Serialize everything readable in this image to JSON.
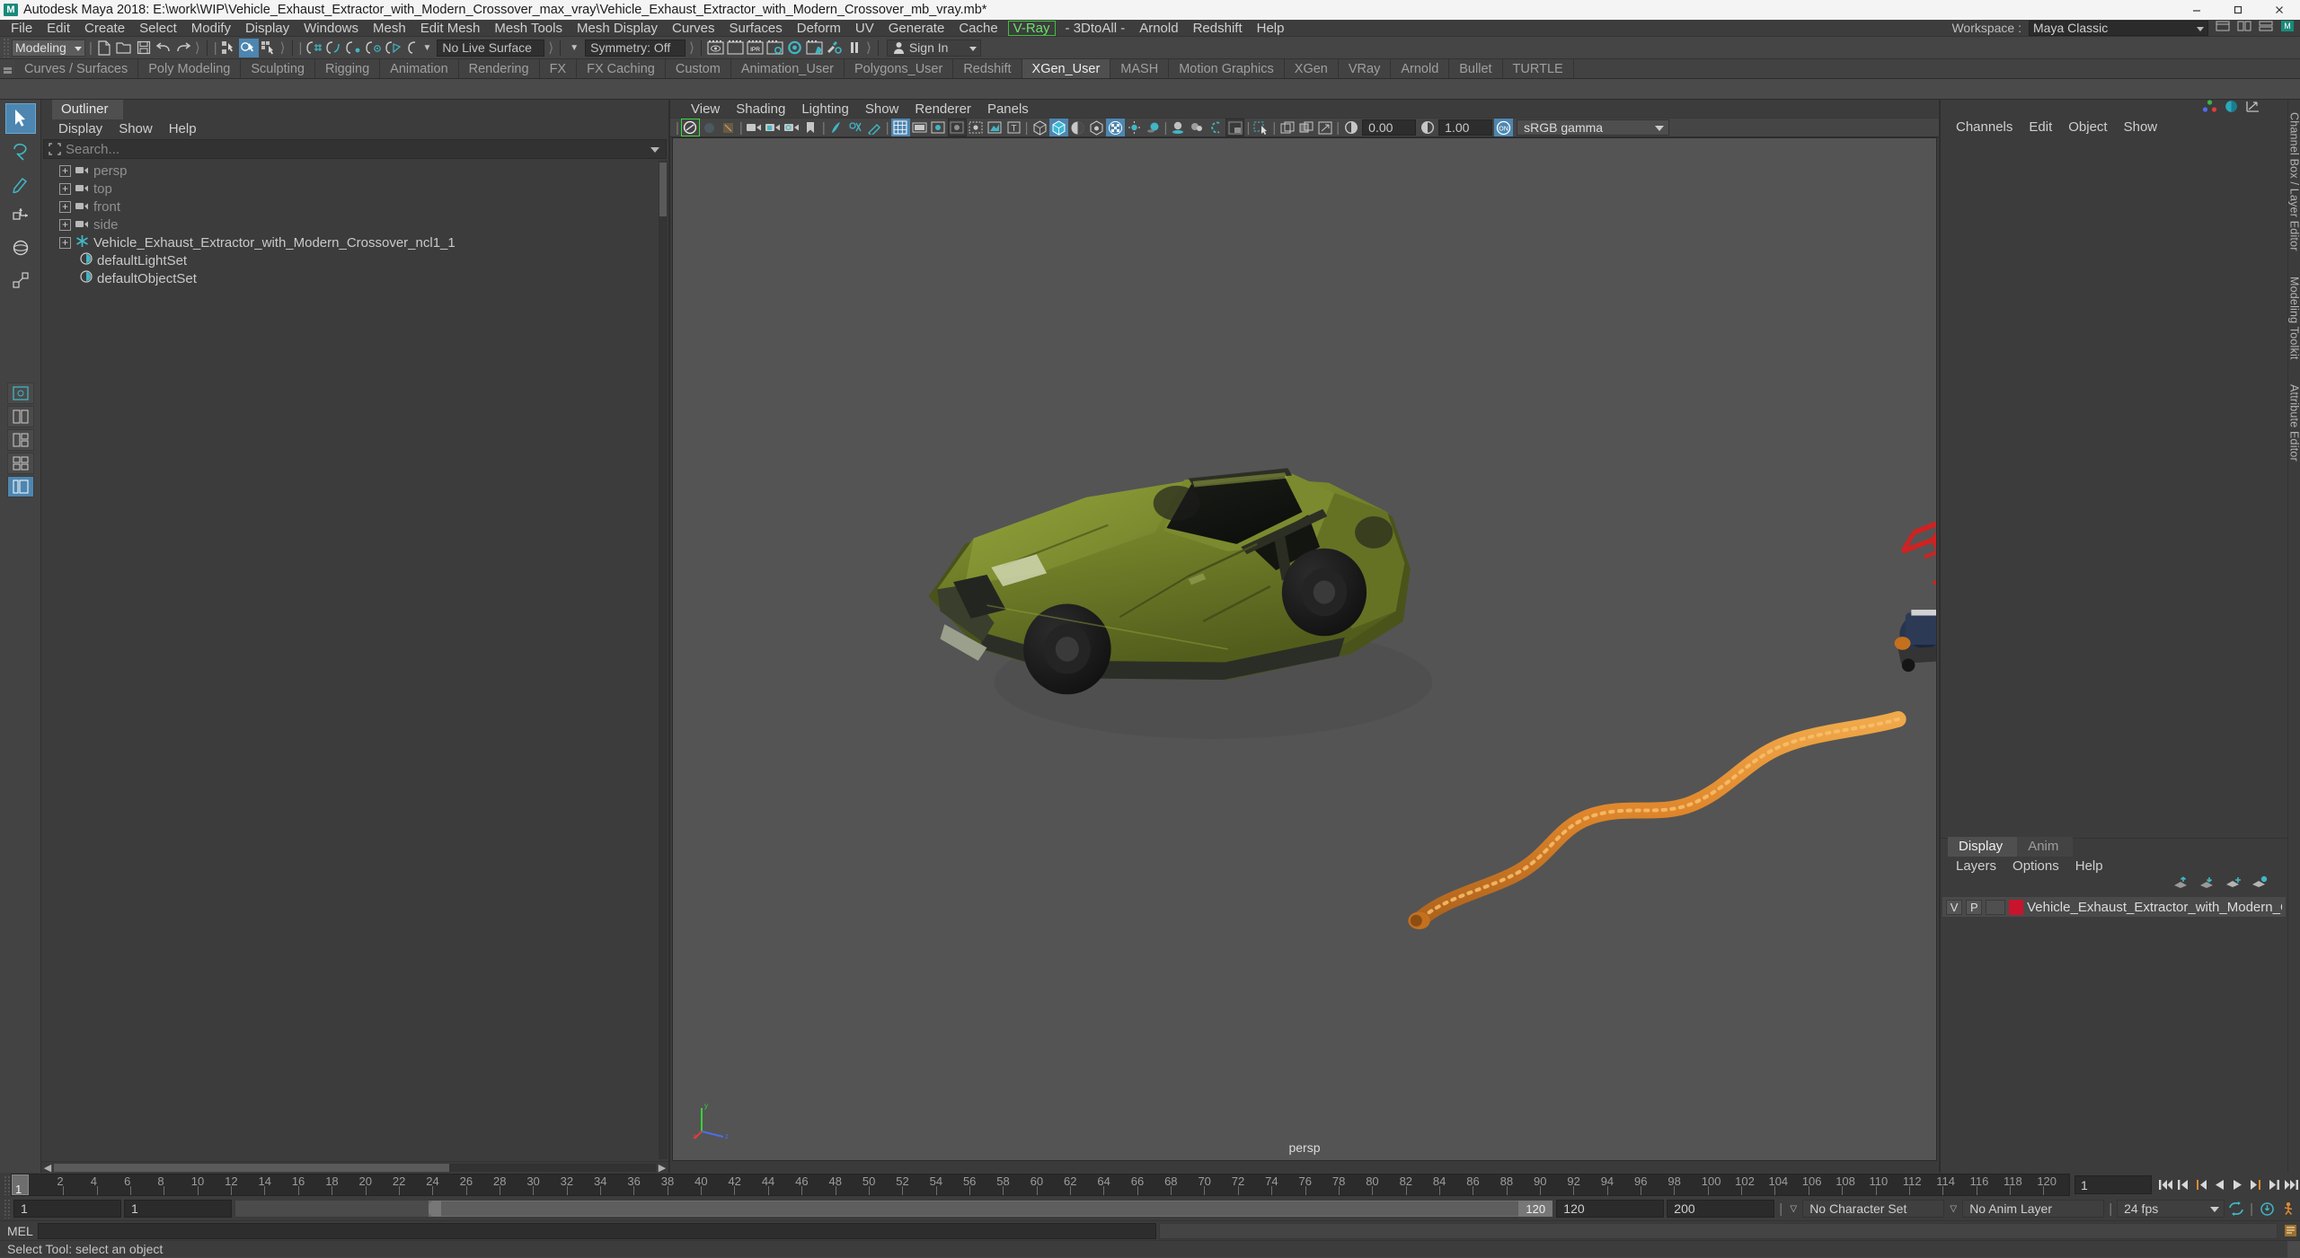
{
  "titlebar": {
    "logo": "M",
    "title": "Autodesk Maya 2018: E:\\work\\WIP\\Vehicle_Exhaust_Extractor_with_Modern_Crossover_max_vray\\Vehicle_Exhaust_Extractor_with_Modern_Crossover_mb_vray.mb*",
    "minimize": "—",
    "maximize": "❐",
    "close": "✕"
  },
  "menubar": {
    "items": [
      {
        "label": "File"
      },
      {
        "label": "Edit"
      },
      {
        "label": "Create"
      },
      {
        "label": "Select"
      },
      {
        "label": "Modify"
      },
      {
        "label": "Display"
      },
      {
        "label": "Windows"
      },
      {
        "label": "Mesh"
      },
      {
        "label": "Edit Mesh"
      },
      {
        "label": "Mesh Tools"
      },
      {
        "label": "Mesh Display"
      },
      {
        "label": "Curves"
      },
      {
        "label": "Surfaces"
      },
      {
        "label": "Deform"
      },
      {
        "label": "UV"
      },
      {
        "label": "Generate"
      },
      {
        "label": "Cache"
      },
      {
        "label": "V-Ray"
      },
      {
        "label": "- 3DtoAll -"
      },
      {
        "label": "Arnold"
      },
      {
        "label": "Redshift"
      },
      {
        "label": "Help"
      }
    ],
    "workspace_label": "Workspace :",
    "workspace_value": "Maya Classic"
  },
  "toolbar": {
    "mode_value": "Modeling",
    "live_surface": "No Live Surface",
    "symmetry": "Symmetry: Off",
    "signin": "Sign In"
  },
  "shelf": {
    "tabs": [
      {
        "label": "Curves / Surfaces",
        "active": false
      },
      {
        "label": "Poly Modeling",
        "active": false
      },
      {
        "label": "Sculpting",
        "active": false
      },
      {
        "label": "Rigging",
        "active": false
      },
      {
        "label": "Animation",
        "active": false
      },
      {
        "label": "Rendering",
        "active": false
      },
      {
        "label": "FX",
        "active": false
      },
      {
        "label": "FX Caching",
        "active": false
      },
      {
        "label": "Custom",
        "active": false
      },
      {
        "label": "Animation_User",
        "active": false
      },
      {
        "label": "Polygons_User",
        "active": false
      },
      {
        "label": "Redshift",
        "active": false
      },
      {
        "label": "XGen_User",
        "active": true
      },
      {
        "label": "MASH",
        "active": false
      },
      {
        "label": "Motion Graphics",
        "active": false
      },
      {
        "label": "XGen",
        "active": false
      },
      {
        "label": "VRay",
        "active": false
      },
      {
        "label": "Arnold",
        "active": false
      },
      {
        "label": "Bullet",
        "active": false
      },
      {
        "label": "TURTLE",
        "active": false
      }
    ]
  },
  "outliner": {
    "tab": "Outliner",
    "menu": [
      "Display",
      "Show",
      "Help"
    ],
    "search_placeholder": "Search...",
    "items": [
      {
        "label": "persp",
        "icon": "camera-icon",
        "expandable": true,
        "dim": true
      },
      {
        "label": "top",
        "icon": "camera-icon",
        "expandable": true,
        "dim": true
      },
      {
        "label": "front",
        "icon": "camera-icon",
        "expandable": true,
        "dim": true
      },
      {
        "label": "side",
        "icon": "camera-icon",
        "expandable": true,
        "dim": true
      },
      {
        "label": "Vehicle_Exhaust_Extractor_with_Modern_Crossover_ncl1_1",
        "icon": "asterisk-icon",
        "expandable": true,
        "dim": false
      },
      {
        "label": "defaultLightSet",
        "icon": "set-icon",
        "expandable": false,
        "dim": false
      },
      {
        "label": "defaultObjectSet",
        "icon": "set-icon",
        "expandable": false,
        "dim": false
      }
    ]
  },
  "viewport": {
    "menu": [
      "View",
      "Shading",
      "Lighting",
      "Show",
      "Renderer",
      "Panels"
    ],
    "exposure": "0.00",
    "gamma": "1.00",
    "color_profile": "sRGB gamma",
    "camera_label": "persp",
    "axis": {
      "x": "x",
      "y": "y",
      "z": "z"
    }
  },
  "channelbox": {
    "menu": [
      "Channels",
      "Edit",
      "Object",
      "Show"
    ],
    "side_tabs": [
      "Channel Box / Layer Editor",
      "Modeling Toolkit",
      "Attribute Editor"
    ]
  },
  "layers": {
    "tabs": [
      {
        "label": "Display",
        "active": true
      },
      {
        "label": "Anim",
        "active": false
      }
    ],
    "menu": [
      "Layers",
      "Options",
      "Help"
    ],
    "rows": [
      {
        "v": "V",
        "p": "P",
        "color": "#c9142e",
        "name": "Vehicle_Exhaust_Extractor_with_Modern_Crossover"
      }
    ]
  },
  "timeslider": {
    "current_frame": "1",
    "frame_field": "1",
    "tick_labels": [
      "2",
      "4",
      "6",
      "8",
      "10",
      "12",
      "14",
      "16",
      "18",
      "20",
      "22",
      "24",
      "26",
      "28",
      "30",
      "32",
      "34",
      "36",
      "38",
      "40",
      "42",
      "44",
      "46",
      "48",
      "50",
      "52",
      "54",
      "56",
      "58",
      "60",
      "62",
      "64",
      "66",
      "68",
      "70",
      "72",
      "74",
      "76",
      "78",
      "80",
      "82",
      "84",
      "86",
      "88",
      "90",
      "92",
      "94",
      "96",
      "98",
      "100",
      "102",
      "104",
      "106",
      "108",
      "110",
      "112",
      "114",
      "116",
      "118",
      "120"
    ]
  },
  "rangebar": {
    "start": "1",
    "anim_start": "1",
    "range_playback_end": "120",
    "range_end": "120",
    "end": "200",
    "character_set": "No Character Set",
    "anim_layer": "No Anim Layer",
    "fps": "24 fps",
    "inner_value": "1"
  },
  "commandline": {
    "language": "MEL"
  },
  "statusline": {
    "message": "Select Tool: select an object"
  },
  "colors": {
    "accent_blue": "#4d86b0",
    "teal_icon": "#41b6c4",
    "vray_green": "#6ee06e",
    "layer_red": "#c9142e",
    "car_body": "#6d7a2a",
    "hose_orange": "#e08a30",
    "viewport_bg": "#545454"
  }
}
